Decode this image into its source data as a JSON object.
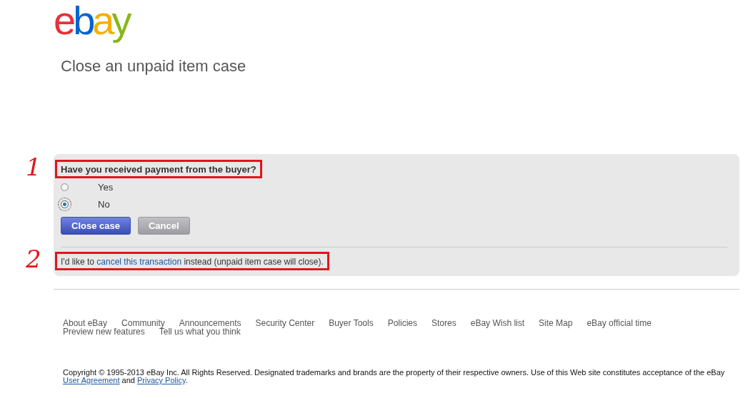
{
  "logo": {
    "letters": [
      {
        "text": "e",
        "color": "#e53238"
      },
      {
        "text": "b",
        "color": "#0064d2"
      },
      {
        "text": "a",
        "color": "#f5af02"
      },
      {
        "text": "y",
        "color": "#86b817"
      }
    ]
  },
  "title": "Close an unpaid item case",
  "question": {
    "text": "Have you received payment from the buyer?",
    "annotation": "1"
  },
  "options": [
    {
      "label": "Yes",
      "selected": false
    },
    {
      "label": "No",
      "selected": true
    }
  ],
  "buttons": [
    {
      "label": "Close case",
      "kind": "primary"
    },
    {
      "label": "Cancel",
      "kind": "secondary"
    }
  ],
  "alternative": {
    "before": "I'd like to",
    "link": "cancel this transaction",
    "after": "instead (unpaid item case will close).",
    "annotation": "2"
  },
  "footer_links": [
    "About eBay",
    "Community",
    "Announcements",
    "Security Center",
    "Buyer Tools",
    "Policies",
    "Stores",
    "eBay Wish list",
    "Site Map",
    "eBay official time",
    "Preview new features",
    "Tell us what you think"
  ],
  "copyright": {
    "text": "Copyright © 1995-2013 eBay Inc. All Rights Reserved. Designated trademarks and brands are the property of their respective owners. Use of this Web site constitutes acceptance of the eBay",
    "links": [
      "User Agreement",
      "Privacy Policy"
    ],
    "joiner": "and",
    "end": "."
  }
}
